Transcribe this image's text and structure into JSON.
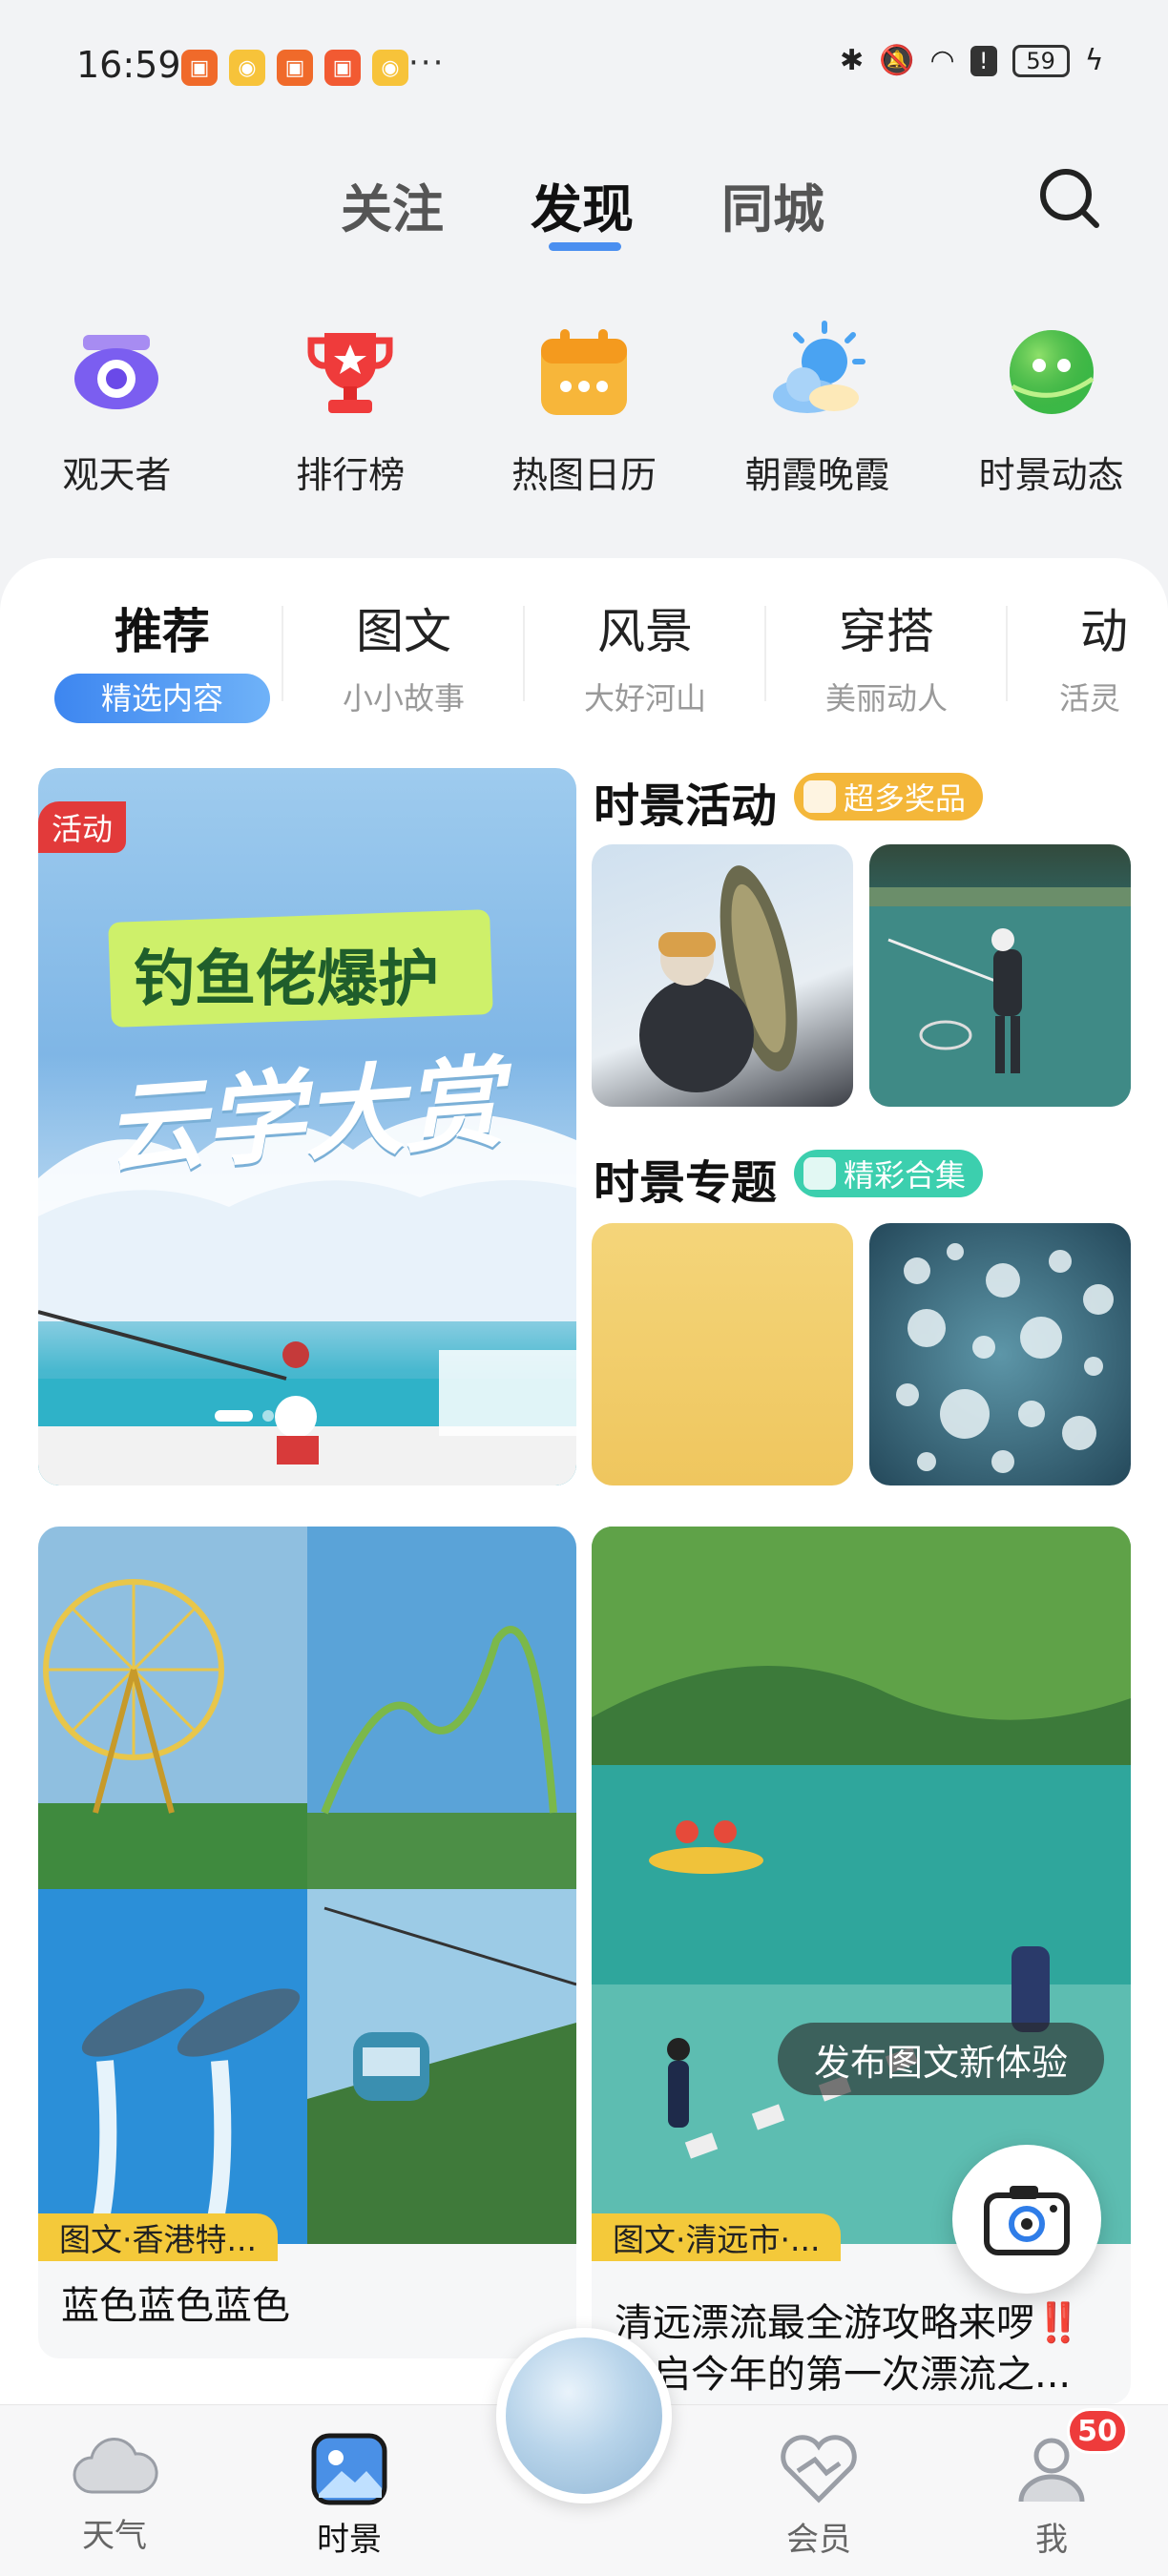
{
  "status_bar": {
    "time": "16:59",
    "battery": "59",
    "more": "···"
  },
  "top_tabs": [
    {
      "label": "关注"
    },
    {
      "label": "发现",
      "active": true
    },
    {
      "label": "同城"
    }
  ],
  "quick_icons": [
    {
      "label": "观天者",
      "icon": "eye-icon"
    },
    {
      "label": "排行榜",
      "icon": "trophy-icon"
    },
    {
      "label": "热图日历",
      "icon": "calendar-icon"
    },
    {
      "label": "朝霞晚霞",
      "icon": "sun-cloud-icon"
    },
    {
      "label": "时景动态",
      "icon": "planet-icon"
    }
  ],
  "categories": [
    {
      "title": "推荐",
      "sub": "精选内容",
      "active": true
    },
    {
      "title": "图文",
      "sub": "小小故事"
    },
    {
      "title": "风景",
      "sub": "大好河山"
    },
    {
      "title": "穿搭",
      "sub": "美丽动人"
    },
    {
      "title": "动",
      "sub": "活灵"
    }
  ],
  "banner": {
    "badge": "活动",
    "title": "钓鱼佬爆护",
    "subtitle": "云学大赏"
  },
  "activities": {
    "title": "时景活动",
    "pill": "超多奖品",
    "pill_color": "#f4b73a"
  },
  "topics": {
    "title": "时景专题",
    "pill": "精彩合集",
    "pill_color": "#3ccfae"
  },
  "posts": [
    {
      "tag": "图文·香港特...",
      "title": "蓝色蓝色蓝色"
    },
    {
      "tag": "图文·清远市·...",
      "title": "清远漂流最全游攻略来啰‼️",
      "title2": "开启今年的第一次漂流之..."
    }
  ],
  "publish_tip": "发布图文新体验",
  "bottom_nav": [
    {
      "label": "天气",
      "icon": "cloud-icon"
    },
    {
      "label": "时景",
      "icon": "picture-icon",
      "active": true
    },
    {
      "label": "会员",
      "icon": "heart-icon"
    },
    {
      "label": "我",
      "icon": "user-icon",
      "badge": "50"
    }
  ]
}
